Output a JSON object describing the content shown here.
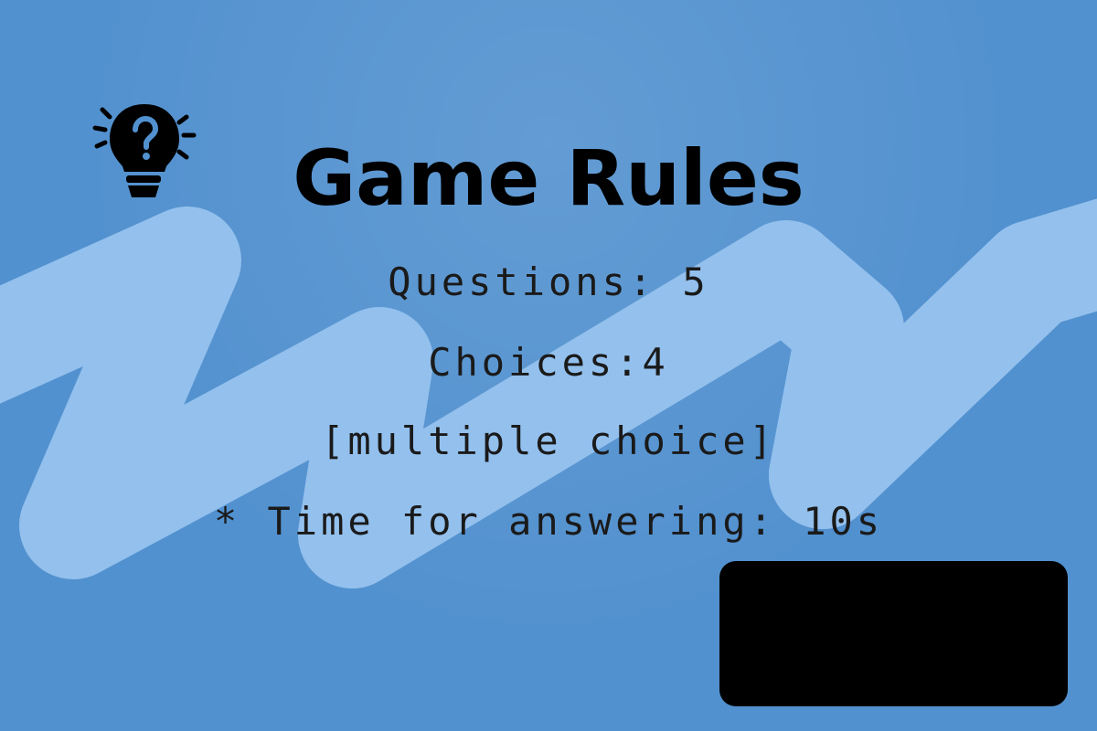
{
  "theme": {
    "background": "#5291cf",
    "zigzag_color": "#93c0ed",
    "text_color": "#000000",
    "button_color": "#000000"
  },
  "header": {
    "icon": "lightbulb-question-icon",
    "title": "Game Rules"
  },
  "rules": {
    "questions": "Questions: 5",
    "choices": "Choices:4",
    "choice_type": "[multiple choice]",
    "time": "* Time for answering: 10s"
  },
  "continue_button": {
    "label": ""
  }
}
